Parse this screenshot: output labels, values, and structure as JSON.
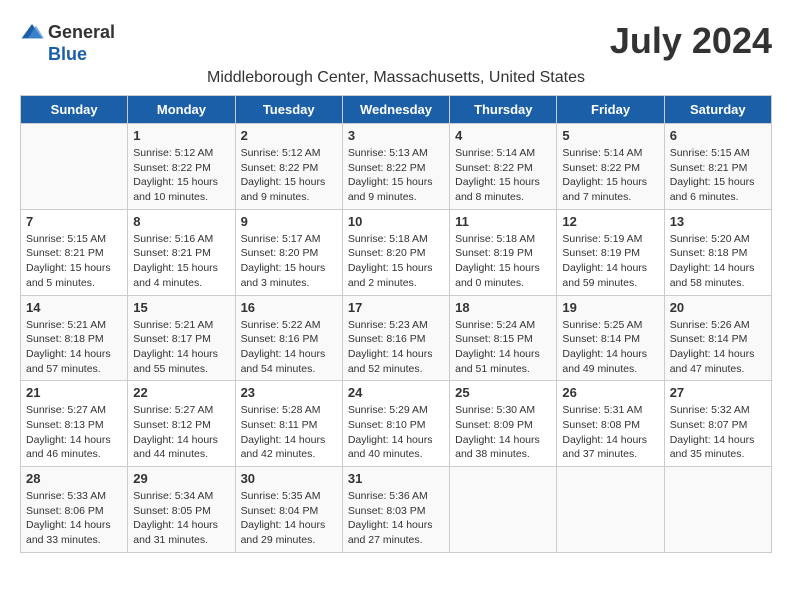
{
  "header": {
    "logo_general": "General",
    "logo_blue": "Blue",
    "month_year": "July 2024",
    "location": "Middleborough Center, Massachusetts, United States"
  },
  "columns": [
    "Sunday",
    "Monday",
    "Tuesday",
    "Wednesday",
    "Thursday",
    "Friday",
    "Saturday"
  ],
  "weeks": [
    [
      {
        "day": "",
        "info": ""
      },
      {
        "day": "1",
        "info": "Sunrise: 5:12 AM\nSunset: 8:22 PM\nDaylight: 15 hours\nand 10 minutes."
      },
      {
        "day": "2",
        "info": "Sunrise: 5:12 AM\nSunset: 8:22 PM\nDaylight: 15 hours\nand 9 minutes."
      },
      {
        "day": "3",
        "info": "Sunrise: 5:13 AM\nSunset: 8:22 PM\nDaylight: 15 hours\nand 9 minutes."
      },
      {
        "day": "4",
        "info": "Sunrise: 5:14 AM\nSunset: 8:22 PM\nDaylight: 15 hours\nand 8 minutes."
      },
      {
        "day": "5",
        "info": "Sunrise: 5:14 AM\nSunset: 8:22 PM\nDaylight: 15 hours\nand 7 minutes."
      },
      {
        "day": "6",
        "info": "Sunrise: 5:15 AM\nSunset: 8:21 PM\nDaylight: 15 hours\nand 6 minutes."
      }
    ],
    [
      {
        "day": "7",
        "info": "Sunrise: 5:15 AM\nSunset: 8:21 PM\nDaylight: 15 hours\nand 5 minutes."
      },
      {
        "day": "8",
        "info": "Sunrise: 5:16 AM\nSunset: 8:21 PM\nDaylight: 15 hours\nand 4 minutes."
      },
      {
        "day": "9",
        "info": "Sunrise: 5:17 AM\nSunset: 8:20 PM\nDaylight: 15 hours\nand 3 minutes."
      },
      {
        "day": "10",
        "info": "Sunrise: 5:18 AM\nSunset: 8:20 PM\nDaylight: 15 hours\nand 2 minutes."
      },
      {
        "day": "11",
        "info": "Sunrise: 5:18 AM\nSunset: 8:19 PM\nDaylight: 15 hours\nand 0 minutes."
      },
      {
        "day": "12",
        "info": "Sunrise: 5:19 AM\nSunset: 8:19 PM\nDaylight: 14 hours\nand 59 minutes."
      },
      {
        "day": "13",
        "info": "Sunrise: 5:20 AM\nSunset: 8:18 PM\nDaylight: 14 hours\nand 58 minutes."
      }
    ],
    [
      {
        "day": "14",
        "info": "Sunrise: 5:21 AM\nSunset: 8:18 PM\nDaylight: 14 hours\nand 57 minutes."
      },
      {
        "day": "15",
        "info": "Sunrise: 5:21 AM\nSunset: 8:17 PM\nDaylight: 14 hours\nand 55 minutes."
      },
      {
        "day": "16",
        "info": "Sunrise: 5:22 AM\nSunset: 8:16 PM\nDaylight: 14 hours\nand 54 minutes."
      },
      {
        "day": "17",
        "info": "Sunrise: 5:23 AM\nSunset: 8:16 PM\nDaylight: 14 hours\nand 52 minutes."
      },
      {
        "day": "18",
        "info": "Sunrise: 5:24 AM\nSunset: 8:15 PM\nDaylight: 14 hours\nand 51 minutes."
      },
      {
        "day": "19",
        "info": "Sunrise: 5:25 AM\nSunset: 8:14 PM\nDaylight: 14 hours\nand 49 minutes."
      },
      {
        "day": "20",
        "info": "Sunrise: 5:26 AM\nSunset: 8:14 PM\nDaylight: 14 hours\nand 47 minutes."
      }
    ],
    [
      {
        "day": "21",
        "info": "Sunrise: 5:27 AM\nSunset: 8:13 PM\nDaylight: 14 hours\nand 46 minutes."
      },
      {
        "day": "22",
        "info": "Sunrise: 5:27 AM\nSunset: 8:12 PM\nDaylight: 14 hours\nand 44 minutes."
      },
      {
        "day": "23",
        "info": "Sunrise: 5:28 AM\nSunset: 8:11 PM\nDaylight: 14 hours\nand 42 minutes."
      },
      {
        "day": "24",
        "info": "Sunrise: 5:29 AM\nSunset: 8:10 PM\nDaylight: 14 hours\nand 40 minutes."
      },
      {
        "day": "25",
        "info": "Sunrise: 5:30 AM\nSunset: 8:09 PM\nDaylight: 14 hours\nand 38 minutes."
      },
      {
        "day": "26",
        "info": "Sunrise: 5:31 AM\nSunset: 8:08 PM\nDaylight: 14 hours\nand 37 minutes."
      },
      {
        "day": "27",
        "info": "Sunrise: 5:32 AM\nSunset: 8:07 PM\nDaylight: 14 hours\nand 35 minutes."
      }
    ],
    [
      {
        "day": "28",
        "info": "Sunrise: 5:33 AM\nSunset: 8:06 PM\nDaylight: 14 hours\nand 33 minutes."
      },
      {
        "day": "29",
        "info": "Sunrise: 5:34 AM\nSunset: 8:05 PM\nDaylight: 14 hours\nand 31 minutes."
      },
      {
        "day": "30",
        "info": "Sunrise: 5:35 AM\nSunset: 8:04 PM\nDaylight: 14 hours\nand 29 minutes."
      },
      {
        "day": "31",
        "info": "Sunrise: 5:36 AM\nSunset: 8:03 PM\nDaylight: 14 hours\nand 27 minutes."
      },
      {
        "day": "",
        "info": ""
      },
      {
        "day": "",
        "info": ""
      },
      {
        "day": "",
        "info": ""
      }
    ]
  ]
}
